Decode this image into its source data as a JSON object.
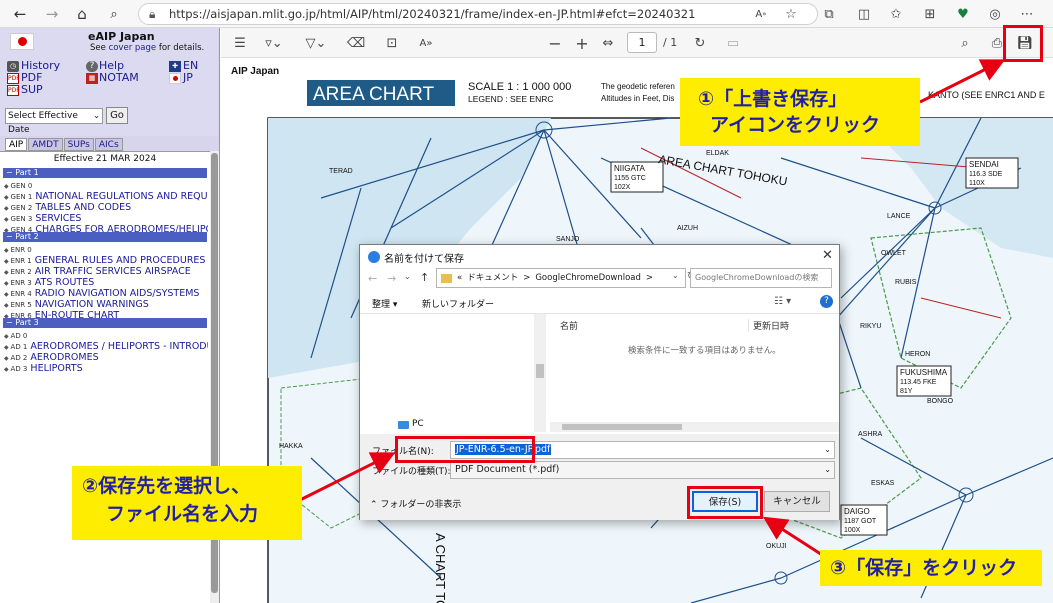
{
  "browser": {
    "url": "https://aisjapan.mlit.go.jp/html/AIP/html/20240321/frame/index-en-JP.html#efct=20240321",
    "icons": [
      "back-icon",
      "forward-icon",
      "home-icon",
      "search-icon",
      "lock-icon",
      "read-aloud-icon",
      "favorite-icon",
      "extensions-icon",
      "split-screen-icon",
      "favorites-bar-icon",
      "collections-icon",
      "browser-essentials-icon",
      "copilot-icon",
      "more-icon"
    ]
  },
  "leftpanel": {
    "title": "eAIP Japan",
    "subtitle_prefix": "See",
    "subtitle_link": "cover page",
    "subtitle_suffix": "for details.",
    "links": {
      "history": "History",
      "help": "Help",
      "en": "EN",
      "pdf": "PDF",
      "notam": "NOTAM",
      "jp": "JP",
      "sup": "SUP"
    },
    "date_select": "Select Effective Date",
    "go_button": "Go",
    "tabs": [
      "AIP",
      "AMDT",
      "SUPs",
      "AICs"
    ],
    "effective": "Effective 21 MAR 2024",
    "parts": [
      "Part 1",
      "Part 2",
      "Part 3"
    ],
    "part1_items": [
      {
        "code": "GEN 0",
        "title": ""
      },
      {
        "code": "GEN 1",
        "title": "NATIONAL REGULATIONS AND REQUIREM"
      },
      {
        "code": "GEN 2",
        "title": "TABLES AND CODES"
      },
      {
        "code": "GEN 3",
        "title": "SERVICES"
      },
      {
        "code": "GEN 4",
        "title": "CHARGES FOR AERODROMES/HELIPORT"
      }
    ],
    "part2_items": [
      {
        "code": "ENR 0",
        "title": ""
      },
      {
        "code": "ENR 1",
        "title": "GENERAL RULES AND PROCEDURES"
      },
      {
        "code": "ENR 2",
        "title": "AIR TRAFFIC SERVICES AIRSPACE"
      },
      {
        "code": "ENR 3",
        "title": "ATS ROUTES"
      },
      {
        "code": "ENR 4",
        "title": "RADIO NAVIGATION AIDS/SYSTEMS"
      },
      {
        "code": "ENR 5",
        "title": "NAVIGATION WARNINGS"
      },
      {
        "code": "ENR 6",
        "title": "EN-ROUTE CHART"
      }
    ],
    "part3_items": [
      {
        "code": "AD 0",
        "title": ""
      },
      {
        "code": "AD 1",
        "title": "AERODROMES / HELIPORTS - INTRODUCTI"
      },
      {
        "code": "AD 2",
        "title": "AERODROMES"
      },
      {
        "code": "AD 3",
        "title": "HELIPORTS"
      }
    ]
  },
  "pdfviewer": {
    "page_current": "1",
    "page_total": "/ 1",
    "zoom_minus": "−",
    "zoom_plus": "+",
    "chart": {
      "header_left": "AIP Japan",
      "title": "AREA CHART",
      "scale": "SCALE   1 : 1 000 000",
      "legend": "LEGEND : SEE ENRC",
      "geodetic_line1": "The geodetic referen",
      "geodetic_line2": "Altitudes in Feet, Dis",
      "kanto_ref": "KANTO   (SEE ENRC1 AND E",
      "labels": {
        "niigata": "NIIGATA",
        "niigata_sub": "1155  GTC",
        "niigata_sub2": "102X",
        "area_tohoku": "AREA CHART TOHOKU",
        "area_tohoku_vertical": "A CHART TOK",
        "sendai": "SENDAI",
        "sendai_sub": "116.3  SDE",
        "sendai_sub2": "110X",
        "fukushima": "FUKUSHIMA",
        "fukushima_sub": "113.45  FKE",
        "fukushima_sub2": "81Y",
        "daigo": "DAIGO",
        "daigo_sub": "1187  GOT",
        "daigo_sub2": "100X",
        "eldak": "ELDAK",
        "aizuh": "AIZUH",
        "sanjo": "SANJO",
        "terad": "TERAD",
        "lance": "LANCE",
        "owlet": "OWLET",
        "rubis": "RUBIS",
        "rikyu": "RIKYU",
        "heron": "HERON",
        "bongo": "BONGO",
        "ashra": "ASHRA",
        "eskas": "ESKAS",
        "okuji": "OKUJI",
        "hakka": "HAKKA"
      }
    }
  },
  "dialog": {
    "title": "名前を付けて保存",
    "breadcrumb": [
      "«",
      "ドキュメント",
      ">",
      "GoogleChromeDownload",
      ">"
    ],
    "search_placeholder": "GoogleChromeDownloadの検索",
    "organize": "整理",
    "new_folder": "新しいフォルダー",
    "col_name": "名前",
    "col_date": "更新日時",
    "empty_message": "検索条件に一致する項目はありません。",
    "tree_item": "PC",
    "filename_label": "ファイル名(N):",
    "filename_value": "JP-ENR-6.5-en-JP.pdf",
    "filetype_label": "ファイルの種類(T):",
    "filetype_value": "PDF Document (*.pdf)",
    "hide_folders": "フォルダーの非表示",
    "save_button": "保存(S)",
    "cancel_button": "キャンセル"
  },
  "annotations": {
    "step1_line1": "①「上書き保存」",
    "step1_line2": "アイコンをクリック",
    "step2_line1": "②保存先を選択し、",
    "step2_line2": "ファイル名を入力",
    "step3": "③「保存」をクリック",
    "highlight_color": "#ffed00",
    "text_color": "#1f1fa8",
    "marker_color": "#e60012"
  }
}
